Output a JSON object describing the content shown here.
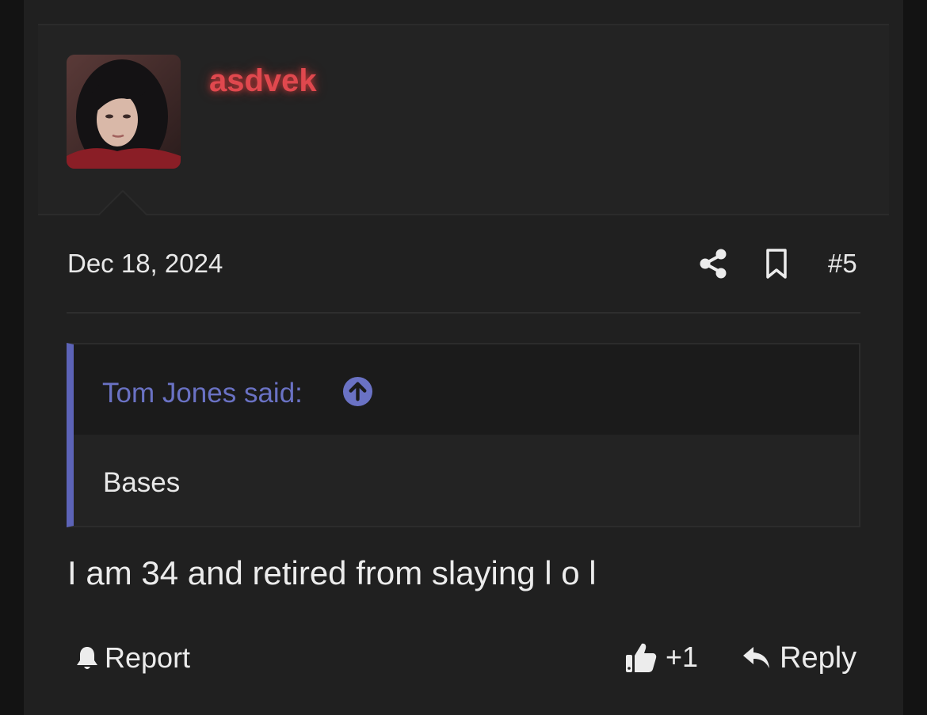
{
  "post": {
    "author": "asdvek",
    "date": "Dec 18, 2024",
    "number": "#5",
    "message": "I am 34 and retired from slaying l o l"
  },
  "quote": {
    "author_label": "Tom Jones said:",
    "body": "Bases"
  },
  "actions": {
    "report_label": "Report",
    "like_count": "+1",
    "reply_label": "Reply"
  },
  "icons": {
    "share": "share-icon",
    "bookmark": "bookmark-icon",
    "quote_jump": "arrow-up-circle-icon",
    "report": "bell-icon",
    "like": "thumbs-up-icon",
    "reply": "reply-arrow-icon"
  },
  "colors": {
    "username": "#e0484e",
    "quote_accent": "#5c63b7",
    "quote_author": "#6a72c4",
    "text": "#e8e8e8",
    "panel": "#202020"
  }
}
